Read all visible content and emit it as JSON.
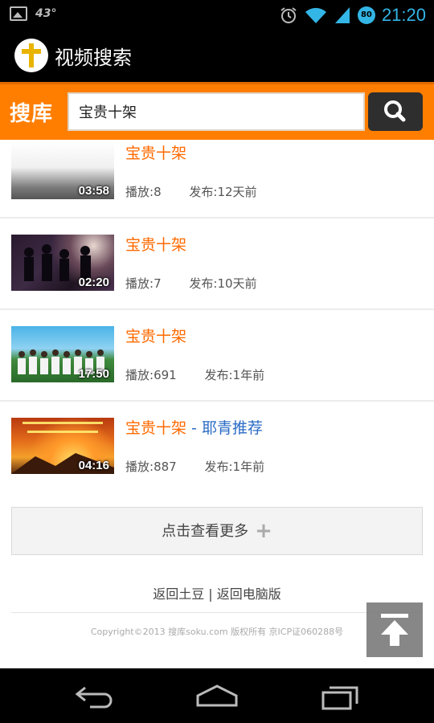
{
  "status_bar": {
    "temperature": "43°",
    "time": "21:20",
    "badge": "80",
    "icons": [
      "image-notification-icon",
      "alarm-icon",
      "wifi-icon",
      "signal-icon",
      "battery-icon"
    ]
  },
  "app_bar": {
    "title": "视频搜索",
    "logo_icon": "cross-logo-icon"
  },
  "search": {
    "brand": "搜库",
    "query": "宝贵十架",
    "button_icon": "search-icon",
    "accent_color": "#ff7e00"
  },
  "results": [
    {
      "title": "宝贵十架",
      "tag": "",
      "duration": "03:58",
      "plays_label": "播放:",
      "plays": "8",
      "published_label": "发布:",
      "published": "12天前"
    },
    {
      "title": "宝贵十架",
      "tag": "",
      "duration": "02:20",
      "plays_label": "播放:",
      "plays": "7",
      "published_label": "发布:",
      "published": "10天前"
    },
    {
      "title": "宝贵十架",
      "tag": "",
      "duration": "17:50",
      "plays_label": "播放:",
      "plays": "691",
      "published_label": "发布:",
      "published": "1年前"
    },
    {
      "title": "宝贵十架",
      "tag": " - 耶青推荐",
      "duration": "04:16",
      "plays_label": "播放:",
      "plays": "887",
      "published_label": "发布:",
      "published": "1年前"
    }
  ],
  "load_more": {
    "label": "点击查看更多",
    "icon": "plus-icon"
  },
  "footer": {
    "link_tudou": "返回土豆",
    "separator": "|",
    "link_pc": "返回电脑版",
    "copyright": "Copyright©2013 搜库soku.com 版权所有 京ICP证060288号"
  },
  "back_to_top_icon": "arrow-up-icon",
  "nav_bar": {
    "icons": [
      "back-icon",
      "home-icon",
      "recent-apps-icon"
    ]
  }
}
